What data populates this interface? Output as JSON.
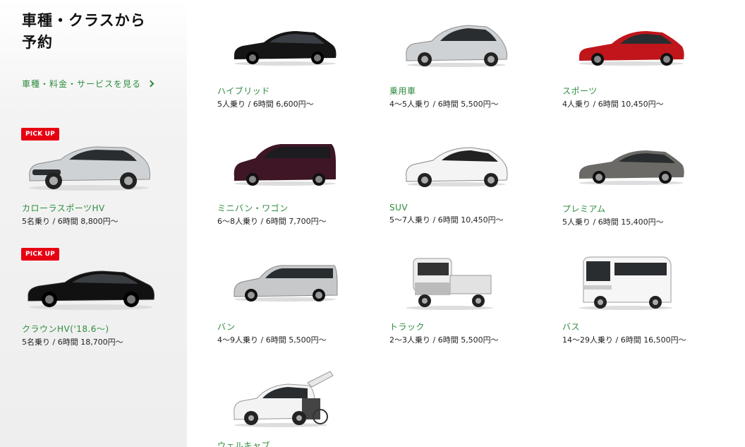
{
  "sidebar": {
    "title": "車種・クラスから\n予約",
    "link_label": "車種・料金・サービスを見る",
    "pickups": [
      {
        "badge": "PICK UP",
        "name": "カローラスポーツHV",
        "spec": "5名乗り / 6時間 8,800円〜"
      },
      {
        "badge": "PICK UP",
        "name": "クラウンHV('18.6〜)",
        "spec": "5名乗り / 6時間 18,700円〜"
      }
    ]
  },
  "classes": [
    {
      "name": "ハイブリッド",
      "spec": "5人乗り / 6時間 6,600円〜",
      "icon": "sedan-black"
    },
    {
      "name": "乗用車",
      "spec": "4〜5人乗り / 6時間 5,500円〜",
      "icon": "hatchback-silver"
    },
    {
      "name": "スポーツ",
      "spec": "4人乗り / 6時間 10,450円〜",
      "icon": "coupe-red"
    },
    {
      "name": "ミニバン・ワゴン",
      "spec": "6〜8人乗り / 6時間 7,700円〜",
      "icon": "minivan-maroon"
    },
    {
      "name": "SUV",
      "spec": "5〜7人乗り / 6時間 10,450円〜",
      "icon": "suv-white"
    },
    {
      "name": "プレミアム",
      "spec": "5人乗り / 6時間 15,400円〜",
      "icon": "sedan-gray"
    },
    {
      "name": "バン",
      "spec": "4〜9人乗り / 6時間 5,500円〜",
      "icon": "van-silver"
    },
    {
      "name": "トラック",
      "spec": "2〜3人乗り / 6時間 5,500円〜",
      "icon": "truck-white"
    },
    {
      "name": "バス",
      "spec": "14〜29人乗り / 6時間 16,500円〜",
      "icon": "bus-white"
    },
    {
      "name": "ウェルキャブ",
      "spec": "",
      "icon": "welcab-white"
    }
  ],
  "colors": {
    "accent": "#2e8b3e",
    "badge": "#e60012"
  }
}
